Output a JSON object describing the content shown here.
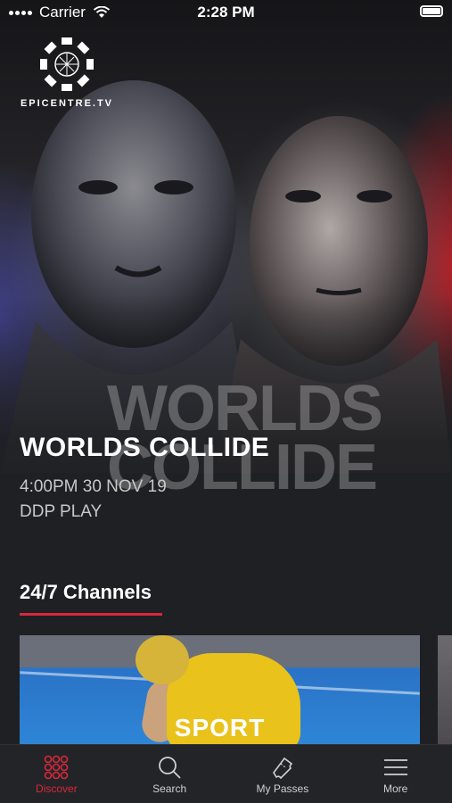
{
  "status_bar": {
    "carrier": "Carrier",
    "time": "2:28 PM"
  },
  "logo": {
    "text": "EPICENTRE.TV"
  },
  "hero": {
    "watermark_line1": "WORLDS",
    "watermark_line2": "COLLIDE",
    "title": "WORLDS COLLIDE",
    "datetime": "4:00PM 30 NOV 19",
    "channel": "DDP PLAY"
  },
  "section": {
    "title": "24/7 Channels"
  },
  "channels": [
    {
      "label": "SPORT"
    }
  ],
  "tab_bar": {
    "tabs": [
      {
        "label": "Discover",
        "icon": "discover-grid-icon",
        "active": true
      },
      {
        "label": "Search",
        "icon": "search-icon",
        "active": false
      },
      {
        "label": "My Passes",
        "icon": "ticket-icon",
        "active": false
      },
      {
        "label": "More",
        "icon": "menu-icon",
        "active": false
      }
    ]
  },
  "colors": {
    "accent": "#d8283c",
    "background": "#1e2023",
    "tab_bar": "#232427"
  }
}
